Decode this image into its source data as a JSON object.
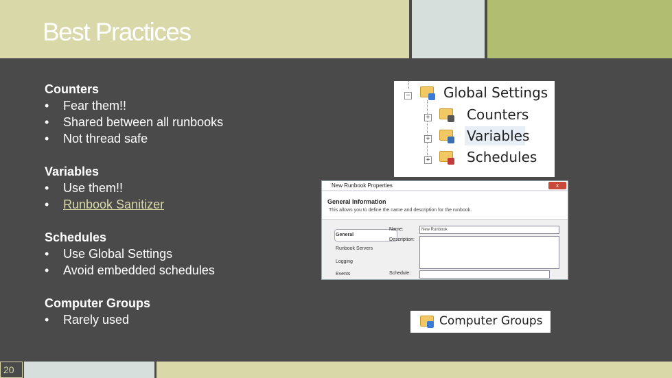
{
  "slide": {
    "title": "Best Practices",
    "page_number": "20"
  },
  "sections": {
    "counters": {
      "heading": "Counters",
      "items": [
        "Fear them!!",
        "Shared between all runbooks",
        "Not thread safe"
      ]
    },
    "variables": {
      "heading": "Variables",
      "items": [
        "Use them!!",
        "Runbook Sanitizer"
      ]
    },
    "schedules": {
      "heading": "Schedules",
      "items": [
        "Use Global Settings",
        "Avoid embedded schedules"
      ]
    },
    "computer_groups": {
      "heading": "Computer Groups",
      "items": [
        "Rarely used"
      ]
    }
  },
  "bullet": "•",
  "global_settings_tree": {
    "root": "Global Settings",
    "children": [
      "Counters",
      "Variables",
      "Schedules"
    ],
    "expander": "+",
    "collapser": "−"
  },
  "runbook_dialog": {
    "window_title": "New Runbook Properties",
    "close_glyph": "x",
    "header_title": "General Information",
    "header_desc": "This allows you to define the name and description for the runbook.",
    "nav": [
      "General",
      "Runbook Servers",
      "Logging",
      "Events"
    ],
    "fields": {
      "name_label": "Name:",
      "name_value": "New Runbook",
      "description_label": "Description:",
      "schedule_label": "Schedule:"
    }
  },
  "computer_groups_node": {
    "label": "Computer Groups"
  },
  "colors": {
    "background": "#4a4a4a",
    "header_band_1": "#d8d8a9",
    "header_band_2": "#d6dfdc",
    "header_band_3": "#b1be72",
    "link": "#d8d8a9"
  },
  "icons": [
    "folder-icon",
    "counters-icon",
    "variables-icon",
    "schedules-icon",
    "computer-groups-icon",
    "global-settings-icon"
  ]
}
